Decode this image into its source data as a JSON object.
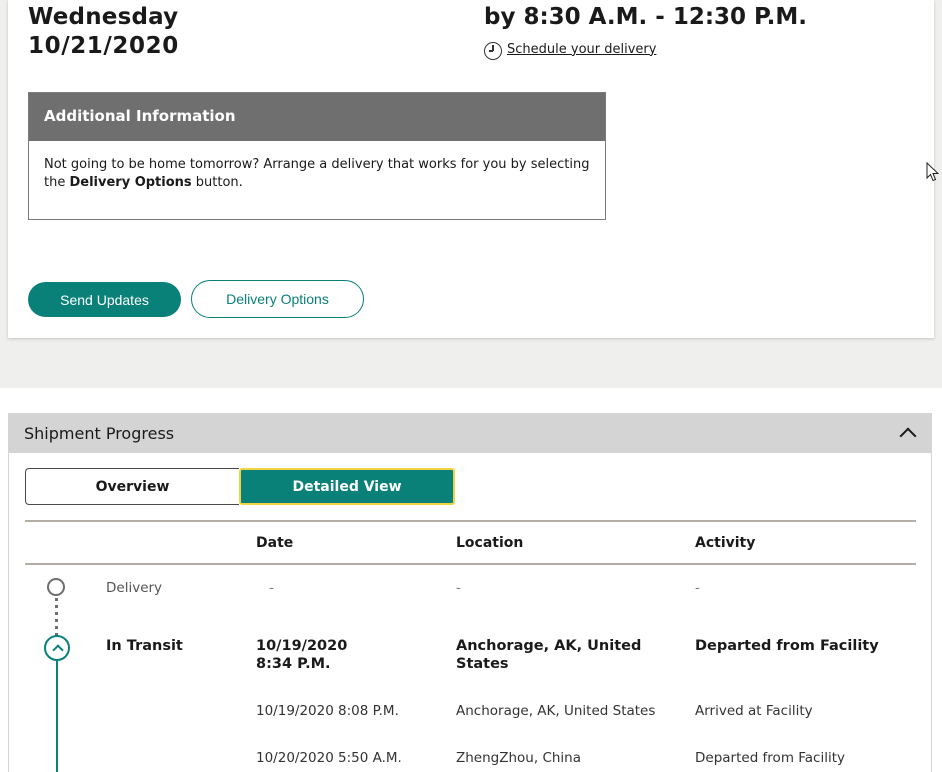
{
  "delivery": {
    "day": "Wednesday",
    "date": "10/21/2020",
    "window": "by 8:30 A.M. - 12:30 P.M.",
    "schedule_link": "Schedule your delivery"
  },
  "info": {
    "title": "Additional Information",
    "text_before": "Not going to be home tomorrow? Arrange a delivery that works for you by selecting the ",
    "text_bold": "Delivery Options",
    "text_after": " button."
  },
  "buttons": {
    "send_updates": "Send Updates",
    "delivery_options": "Delivery Options"
  },
  "progress": {
    "title": "Shipment Progress",
    "tabs": {
      "overview": "Overview",
      "detailed": "Detailed View"
    },
    "columns": {
      "date": "Date",
      "location": "Location",
      "activity": "Activity"
    },
    "rows": {
      "delivery": {
        "status": "Delivery",
        "date": "-",
        "location": "-",
        "activity": "-"
      },
      "in_transit": {
        "status": "In Transit",
        "date_line1": "10/19/2020",
        "date_line2": "8:34 P.M.",
        "location_line1": "Anchorage, AK, United",
        "location_line2": "States",
        "activity": "Departed from Facility"
      },
      "event1": {
        "date": "10/19/2020",
        "time": "8:08 P.M.",
        "location": "Anchorage, AK, United States",
        "activity": "Arrived at Facility"
      },
      "event2": {
        "date": "10/20/2020",
        "time": "5:50 A.M.",
        "location": "ZhengZhou, China",
        "activity": "Departed from Facility"
      }
    }
  },
  "colors": {
    "accent": "#0a8178",
    "focus": "#f0d341",
    "header_gray": "#6f6f6f"
  }
}
